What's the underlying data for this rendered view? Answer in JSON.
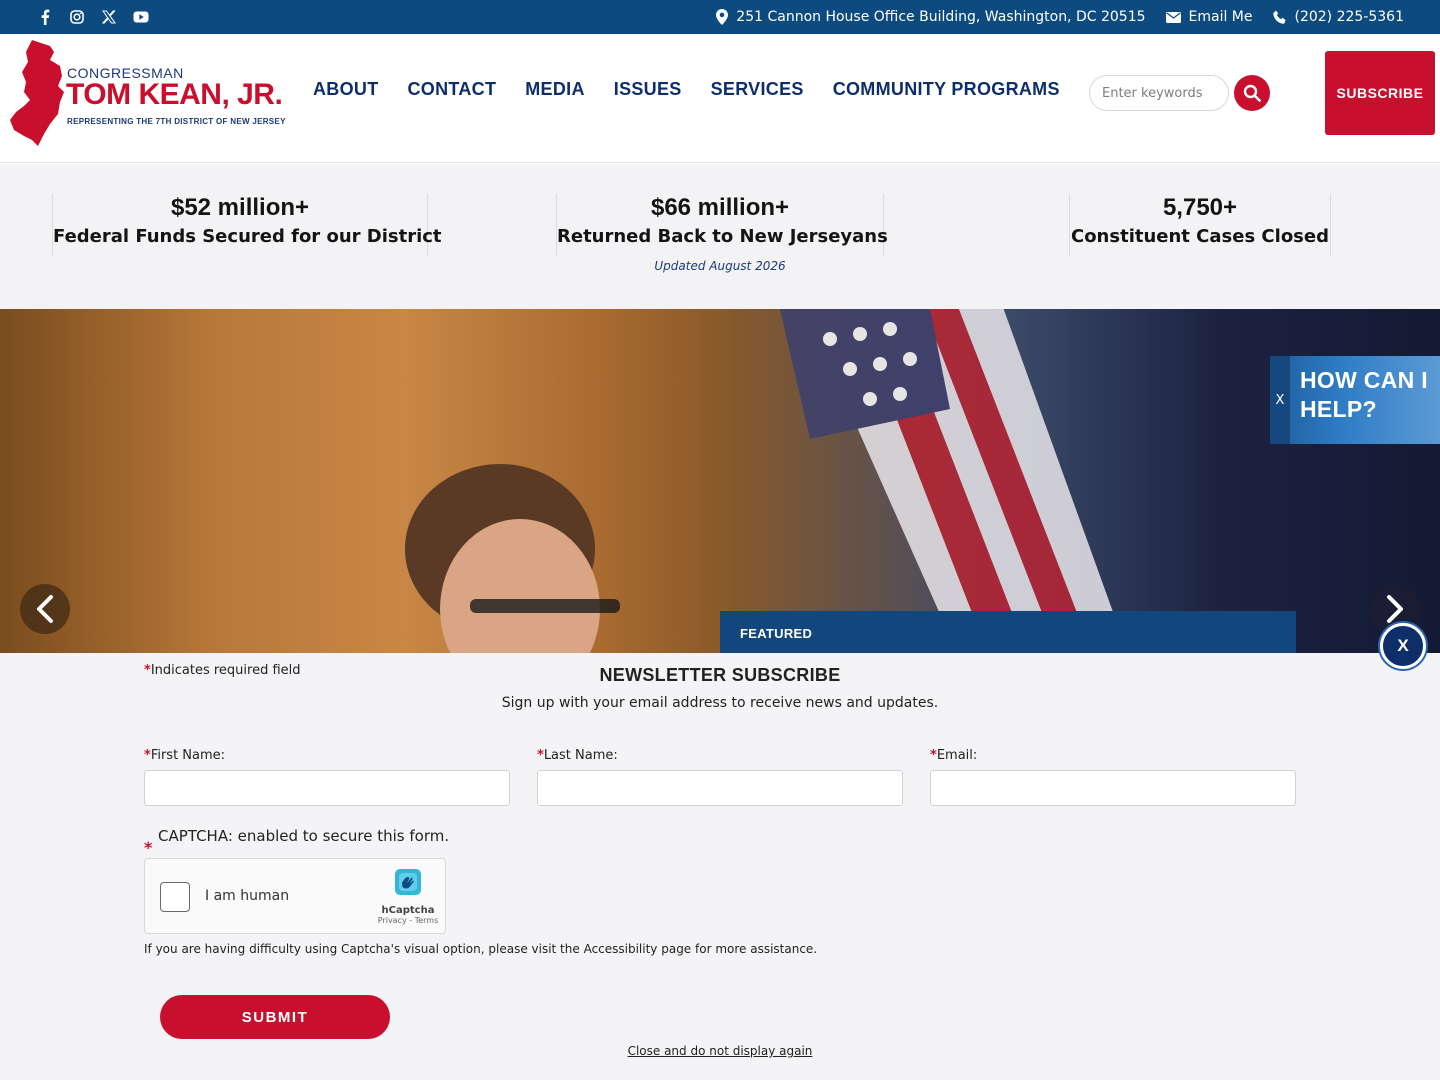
{
  "topbar": {
    "social": [
      {
        "icon": "facebook-icon"
      },
      {
        "icon": "instagram-icon"
      },
      {
        "icon": "x-twitter-icon"
      },
      {
        "icon": "youtube-icon"
      }
    ],
    "address": "251 Cannon House Office Building, Washington, DC 20515",
    "email_label": "Email Me",
    "phone": "(202) 225-5361"
  },
  "header": {
    "logo": {
      "congressman": "CONGRESSMAN",
      "name": "TOM KEAN, JR.",
      "tagline": "REPRESENTING THE 7TH DISTRICT OF NEW JERSEY"
    },
    "nav": [
      "ABOUT",
      "CONTACT",
      "MEDIA",
      "ISSUES",
      "SERVICES",
      "COMMUNITY PROGRAMS"
    ],
    "search_placeholder": "Enter keywords",
    "subscribe_label": "SUBSCRIBE"
  },
  "stats": {
    "items": [
      {
        "value": "$52 million+",
        "label": "Federal Funds Secured for our District"
      },
      {
        "value": "$66 million+",
        "label": "Returned Back to New Jerseyans"
      },
      {
        "value": "5,750+",
        "label": "Constituent Cases Closed"
      }
    ],
    "updated": "Updated August 2026"
  },
  "hero": {
    "featured_label": "FEATURED"
  },
  "help_widget": {
    "close": "X",
    "text_line1": "HOW CAN I",
    "text_line2": "HELP?"
  },
  "newsletter": {
    "required_note": "Indicates required field",
    "title": "NEWSLETTER SUBSCRIBE",
    "subtitle": "Sign up with your email address to receive news and updates.",
    "fields": [
      {
        "label": "First Name:",
        "value": ""
      },
      {
        "label": "Last Name:",
        "value": ""
      },
      {
        "label": "Email:",
        "value": ""
      }
    ],
    "captcha_label": "CAPTCHA: enabled to secure this form.",
    "captcha_checkbox": "I am human",
    "captcha_brand": "hCaptcha",
    "captcha_links": "Privacy - Terms",
    "captcha_note": "If you are having difficulty using Captcha's visual option, please visit the Accessibility page for more assistance.",
    "submit_label": "SUBMIT",
    "close_again": "Close and do not display again",
    "close_button": "X"
  },
  "colors": {
    "topbar": "#0d4a80",
    "brand_red": "#c8102e",
    "nav_text": "#0d2e68",
    "featured_bar": "#11477d"
  }
}
